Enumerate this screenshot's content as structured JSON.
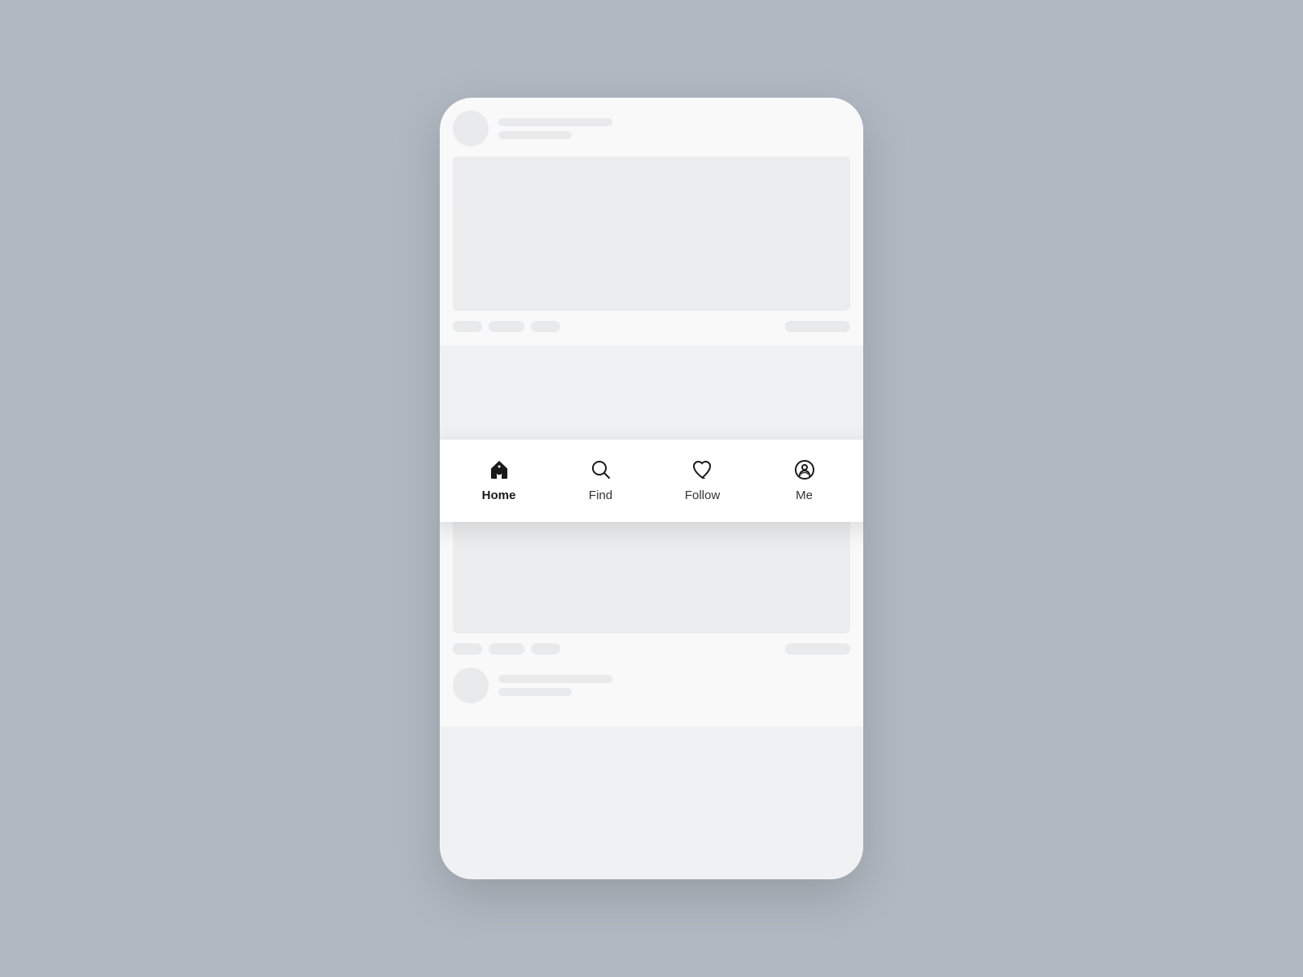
{
  "background_color": "#b0b8c1",
  "nav": {
    "items": [
      {
        "id": "home",
        "label": "Home",
        "active": true,
        "icon": "home-icon"
      },
      {
        "id": "find",
        "label": "Find",
        "active": false,
        "icon": "search-icon"
      },
      {
        "id": "follow",
        "label": "Follow",
        "active": false,
        "icon": "heart-icon"
      },
      {
        "id": "me",
        "label": "Me",
        "active": false,
        "icon": "profile-icon"
      }
    ]
  },
  "feed": {
    "post1": {
      "name_bar_long": "",
      "name_bar_short": "",
      "image": "",
      "actions": []
    },
    "post2": {
      "name_bar_long": "",
      "name_bar_short": "",
      "image": "",
      "actions": []
    }
  }
}
